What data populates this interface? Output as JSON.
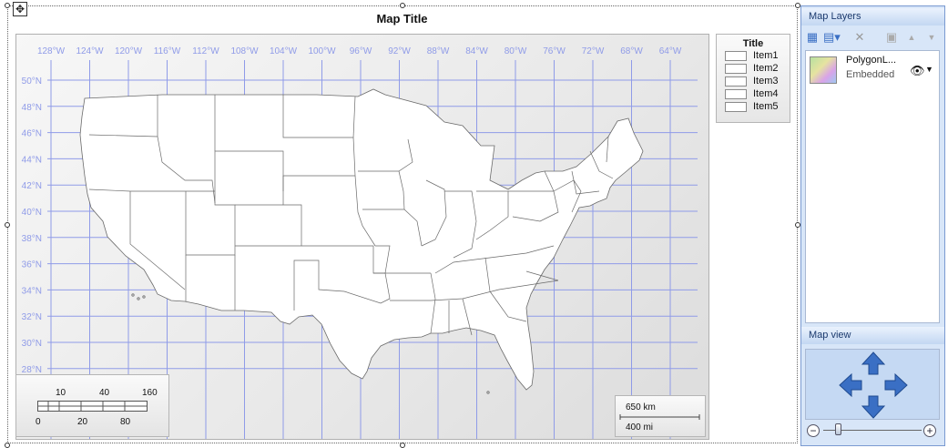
{
  "map": {
    "title": "Map Title",
    "lon_labels": [
      "128°W",
      "124°W",
      "120°W",
      "116°W",
      "112°W",
      "108°W",
      "104°W",
      "100°W",
      "96°W",
      "92°W",
      "88°W",
      "84°W",
      "80°W",
      "76°W",
      "72°W",
      "68°W",
      "64°W"
    ],
    "lat_labels": [
      "50°N",
      "48°N",
      "46°N",
      "44°N",
      "42°N",
      "40°N",
      "38°N",
      "36°N",
      "34°N",
      "32°N",
      "30°N",
      "28°N"
    ],
    "grid_color": "#8f9be8",
    "label_color": "#8f9be8"
  },
  "legend": {
    "title": "Title",
    "items": [
      "Item1",
      "Item2",
      "Item3",
      "Item4",
      "Item5"
    ]
  },
  "scale_bar_numeric": {
    "top_labels": [
      "10",
      "40",
      "160"
    ],
    "bottom_labels": [
      "0",
      "20",
      "80"
    ]
  },
  "scale_bar_distance": {
    "km": "650 km",
    "mi": "400 mi"
  },
  "panel": {
    "layers_header": "Map Layers",
    "layer": {
      "name": "PolygonL...",
      "source": "Embedded"
    },
    "mapview_header": "Map view",
    "accent": "#3a6fc4"
  }
}
